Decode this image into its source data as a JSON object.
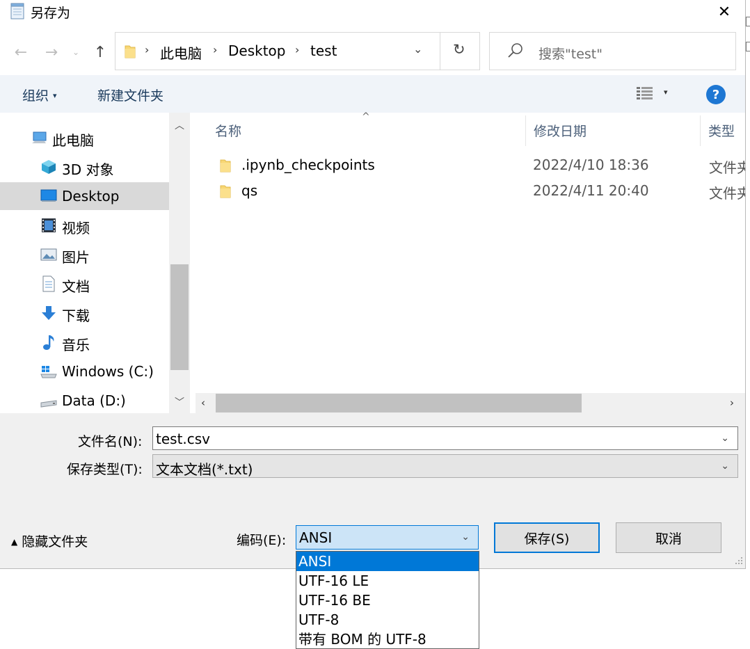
{
  "window": {
    "title": "另存为",
    "close_glyph": "✕"
  },
  "address": {
    "crumbs": [
      "此电脑",
      "Desktop",
      "test"
    ],
    "separator": "›",
    "dropdown_glyph": "⌄",
    "refresh_glyph": "↻"
  },
  "search": {
    "placeholder": "搜索\"test\""
  },
  "toolbar": {
    "organize_label": "组织",
    "new_folder_label": "新建文件夹",
    "help_glyph": "?"
  },
  "nav": {
    "items": [
      {
        "label": "此电脑",
        "icon": "computer-icon"
      },
      {
        "label": "3D 对象",
        "icon": "3d-objects-icon"
      },
      {
        "label": "Desktop",
        "icon": "desktop-icon",
        "selected": true
      },
      {
        "label": "视频",
        "icon": "video-icon"
      },
      {
        "label": "图片",
        "icon": "picture-icon"
      },
      {
        "label": "文档",
        "icon": "document-icon"
      },
      {
        "label": "下载",
        "icon": "download-icon"
      },
      {
        "label": "音乐",
        "icon": "music-icon"
      },
      {
        "label": "Windows (C:)",
        "icon": "system-drive-icon"
      },
      {
        "label": "Data (D:)",
        "icon": "drive-icon"
      }
    ]
  },
  "files": {
    "columns": {
      "name": "名称",
      "modified": "修改日期",
      "type": "类型"
    },
    "rows": [
      {
        "name": ".ipynb_checkpoints",
        "modified": "2022/4/10 18:36",
        "type": "文件夹"
      },
      {
        "name": "qs",
        "modified": "2022/4/11 20:40",
        "type": "文件夹"
      }
    ]
  },
  "form": {
    "filename_label": "文件名(N):",
    "filename_value": "test.csv",
    "filetype_label": "保存类型(T):",
    "filetype_value": "文本文档(*.txt)",
    "hide_folders_label": "隐藏文件夹",
    "encoding_label": "编码(E):",
    "encoding_value": "ANSI",
    "encoding_options": [
      "ANSI",
      "UTF-16 LE",
      "UTF-16 BE",
      "UTF-8",
      "带有 BOM 的 UTF-8"
    ],
    "save_label": "保存(S)",
    "cancel_label": "取消"
  },
  "colors": {
    "accent": "#0078d7",
    "selection": "#cce4f7",
    "toolbar_bg": "#f0f4f9",
    "help": "#1e77d3"
  }
}
